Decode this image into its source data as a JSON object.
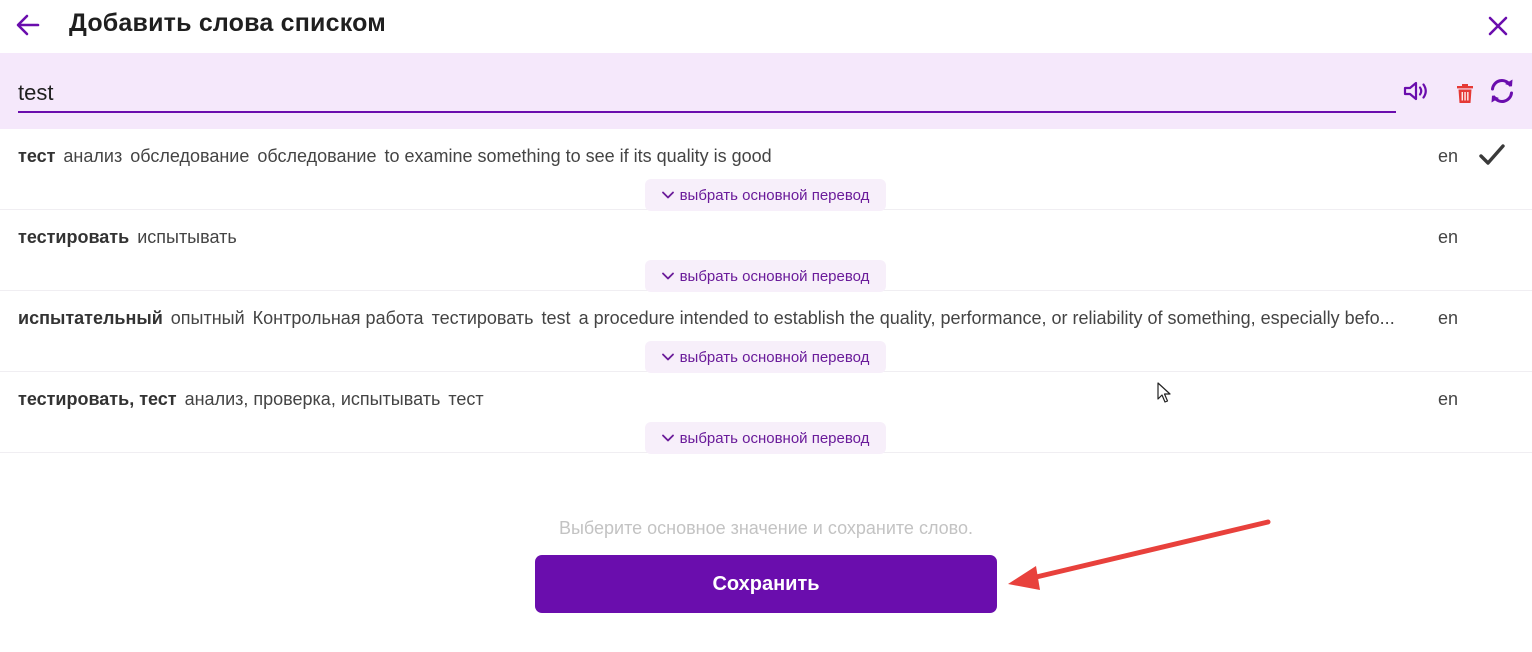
{
  "header": {
    "title": "Добавить слова списком",
    "back_icon": "arrow-left-icon",
    "close_icon": "close-icon"
  },
  "search": {
    "value": "test",
    "speaker_icon": "speaker-icon",
    "delete_icon": "trash-icon",
    "refresh_icon": "refresh-icon"
  },
  "rows": [
    {
      "main": "тест",
      "words": [
        "анализ",
        "обследование",
        "обследование",
        "to examine something to see if its quality is good"
      ],
      "lang": "en",
      "selected": true,
      "choose_label": "выбрать основной перевод"
    },
    {
      "main": "тестировать",
      "words": [
        "испытывать"
      ],
      "lang": "en",
      "selected": false,
      "choose_label": "выбрать основной перевод"
    },
    {
      "main": "испытательный",
      "words": [
        "опытный",
        "Контрольная работа",
        "тестировать",
        "test",
        "a procedure intended to establish the quality, performance, or reliability of something, especially befo..."
      ],
      "lang": "en",
      "selected": false,
      "choose_label": "выбрать основной перевод"
    },
    {
      "main": "тестировать, тест",
      "words": [
        "анализ, проверка, испытывать",
        "тест"
      ],
      "lang": "en",
      "selected": false,
      "choose_label": "выбрать основной перевод"
    }
  ],
  "footer": {
    "hint": "Выберите основное значение и сохраните слово.",
    "save_label": "Сохранить"
  },
  "colors": {
    "accent": "#6a0dad",
    "search_bg": "#f5e8fb",
    "delete": "#e53935",
    "annotation_arrow": "#e8413c"
  }
}
